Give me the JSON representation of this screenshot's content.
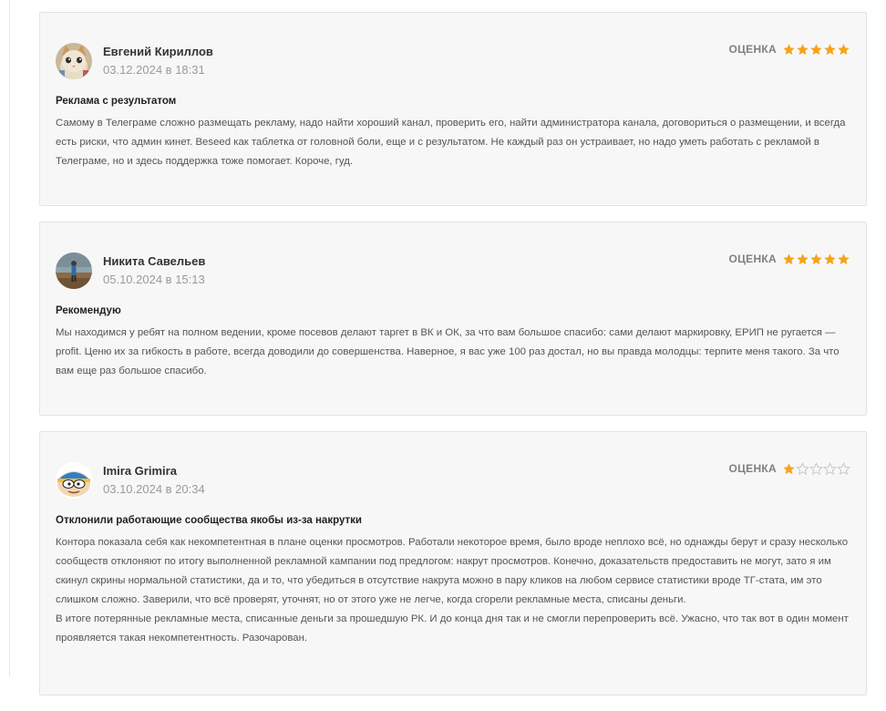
{
  "rating_label": "ОЦЕНКА",
  "colors": {
    "star_filled": "#f5a31a",
    "star_empty": "#c8c8c8",
    "card_bg": "#f7f7f7"
  },
  "reviews": [
    {
      "author": "Евгений Кириллов",
      "date": "03.12.2024 в 18:31",
      "rating": 5,
      "avatar_icon": "kitten-avatar-icon",
      "title": "Реклама с результатом",
      "body": "Самому в Телеграме сложно размещать рекламу, надо найти хороший канал, проверить его, найти администратора канала, договориться о размещении, и всегда есть риски, что админ кинет. Beseed как таблетка от головной боли, еще и с результатом. Не каждый раз он устраивает, но надо уметь работать с рекламой в Телеграме, но и здесь поддержка тоже помогает. Короче, гуд."
    },
    {
      "author": "Никита Савельев",
      "date": "05.10.2024 в 15:13",
      "rating": 5,
      "avatar_icon": "person-outdoor-avatar-icon",
      "title": "Рекомендую",
      "body": "Мы находимся у ребят на полном ведении, кроме посевов делают таргет в ВК и ОК, за что вам большое спасибо: сами делают маркировку, ЕРИП не ругается — profit. Ценю их за гибкость в работе, всегда доводили до совершенства. Наверное, я вас уже 100 раз достал, но вы правда молодцы: терпите меня такого. За что вам еще раз большое спасибо."
    },
    {
      "author": "Imira Grimira",
      "date": "03.10.2024 в 20:34",
      "rating": 1,
      "avatar_icon": "cartoon-character-avatar-icon",
      "title": "Отклонили работающие сообщества якобы из-за накрутки",
      "body": "Контора показала себя как некомпетентная в плане оценки просмотров. Работали некоторое время, было вроде неплохо всё, но однажды берут и сразу несколько сообществ отклоняют по итогу выполненной рекламной кампании под предлогом: накрут просмотров. Конечно, доказательств предоставить не могут, зато я им скинул скрины нормальной статистики, да и то, что убедиться в отсутствие накрута можно в пару кликов на любом сервисе статистики вроде ТГ-стата, им это слишком сложно. Заверили, что всё проверят, уточнят, но от этого уже не легче, когда сгорели рекламные места, списаны деньги.\nВ итоге потерянные рекламные места, списанные деньги за прошедшую РК. И до конца дня так и не смогли перепроверить всё. Ужасно, что так вот в один момент проявляется такая некомпетентность. Разочарован."
    }
  ]
}
